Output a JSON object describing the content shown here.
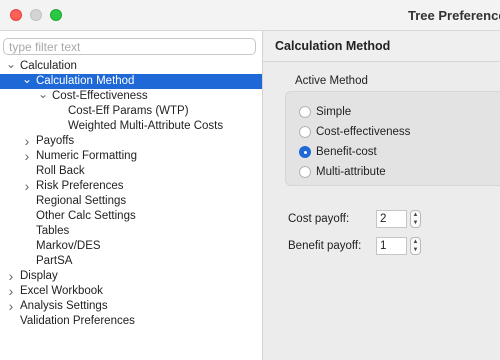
{
  "window": {
    "title": "Tree Preferences"
  },
  "filter": {
    "placeholder": "type filter text",
    "value": ""
  },
  "tree": {
    "items": [
      {
        "label": "Calculation",
        "level": 0,
        "arrow": "down",
        "selected": false
      },
      {
        "label": "Calculation Method",
        "level": 1,
        "arrow": "down",
        "selected": true
      },
      {
        "label": "Cost-Effectiveness",
        "level": 2,
        "arrow": "down",
        "selected": false
      },
      {
        "label": "Cost-Eff Params (WTP)",
        "level": 3,
        "arrow": "none",
        "selected": false
      },
      {
        "label": "Weighted Multi-Attribute Costs",
        "level": 3,
        "arrow": "none",
        "selected": false
      },
      {
        "label": "Payoffs",
        "level": 1,
        "arrow": "right",
        "selected": false
      },
      {
        "label": "Numeric Formatting",
        "level": 1,
        "arrow": "right",
        "selected": false
      },
      {
        "label": "Roll Back",
        "level": 1,
        "arrow": "none",
        "selected": false
      },
      {
        "label": "Risk Preferences",
        "level": 1,
        "arrow": "right",
        "selected": false
      },
      {
        "label": "Regional Settings",
        "level": 1,
        "arrow": "none",
        "selected": false
      },
      {
        "label": "Other Calc Settings",
        "level": 1,
        "arrow": "none",
        "selected": false
      },
      {
        "label": "Tables",
        "level": 1,
        "arrow": "none",
        "selected": false
      },
      {
        "label": "Markov/DES",
        "level": 1,
        "arrow": "none",
        "selected": false
      },
      {
        "label": "PartSA",
        "level": 1,
        "arrow": "none",
        "selected": false
      },
      {
        "label": "Display",
        "level": 0,
        "arrow": "right",
        "selected": false
      },
      {
        "label": "Excel Workbook",
        "level": 0,
        "arrow": "right",
        "selected": false
      },
      {
        "label": "Analysis Settings",
        "level": 0,
        "arrow": "right",
        "selected": false
      },
      {
        "label": "Validation Preferences",
        "level": 0,
        "arrow": "none",
        "selected": false
      }
    ]
  },
  "panel": {
    "title": "Calculation Method",
    "group_label": "Active Method",
    "options": [
      {
        "label": "Simple",
        "checked": false
      },
      {
        "label": "Cost-effectiveness",
        "checked": false
      },
      {
        "label": "Benefit-cost",
        "checked": true
      },
      {
        "label": "Multi-attribute",
        "checked": false
      }
    ],
    "cost_payoff_label": "Cost payoff:",
    "cost_payoff_value": "2",
    "benefit_payoff_label": "Benefit payoff:",
    "benefit_payoff_value": "1"
  },
  "colors": {
    "accent": "#1e68d7",
    "close": "#fe5f57",
    "maximize": "#28c840"
  }
}
